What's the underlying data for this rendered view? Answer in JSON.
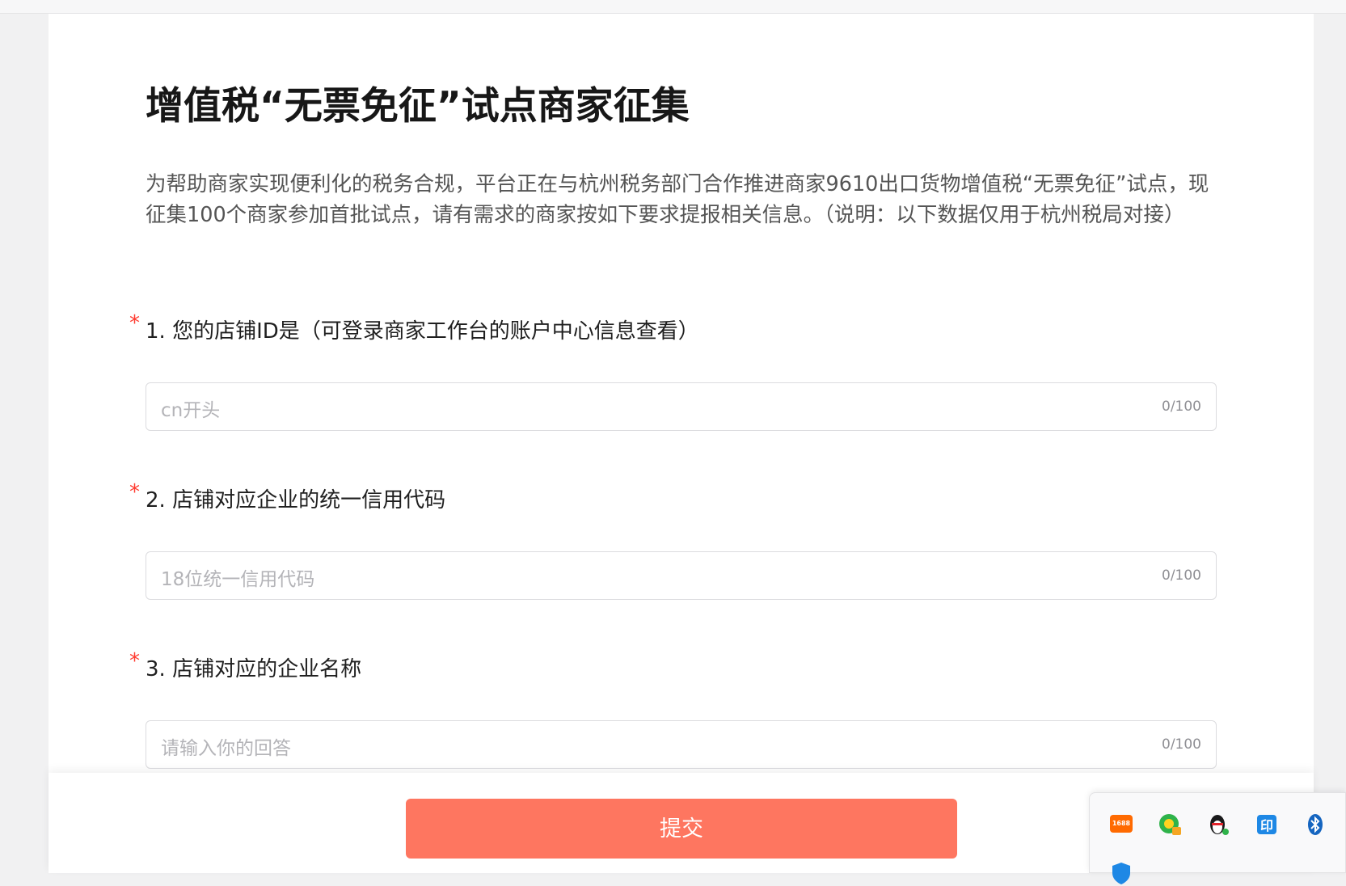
{
  "page": {
    "title": "增值税“无票免征”试点商家征集",
    "intro": "为帮助商家实现便利化的税务合规，平台正在与杭州税务部门合作推进商家9610出口货物增值税“无票免征”试点，现征集100个商家参加首批试点，请有需求的商家按如下要求提报相关信息。（说明：以下数据仅用于杭州税局对接）"
  },
  "questions": [
    {
      "required_mark": "*",
      "label": "1. 您的店铺ID是（可登录商家工作台的账户中心信息查看）",
      "placeholder": "cn开头",
      "counter": "0/100"
    },
    {
      "required_mark": "*",
      "label": "2. 店铺对应企业的统一信用代码",
      "placeholder": "18位统一信用代码",
      "counter": "0/100"
    },
    {
      "required_mark": "*",
      "label": "3. 店铺对应的企业名称",
      "placeholder": "请输入你的回答",
      "counter": "0/100"
    }
  ],
  "footer": {
    "submit_label": "提交"
  },
  "tray": {
    "icons": [
      "1688-app-icon",
      "browser-update-icon",
      "qq-penguin-icon",
      "print-app-icon",
      "bluetooth-icon",
      "security-shield-icon"
    ],
    "badge_1688": "1688"
  },
  "colors": {
    "accent": "#fe7660",
    "required": "#ff3b30",
    "placeholder": "#b4b4b8"
  }
}
